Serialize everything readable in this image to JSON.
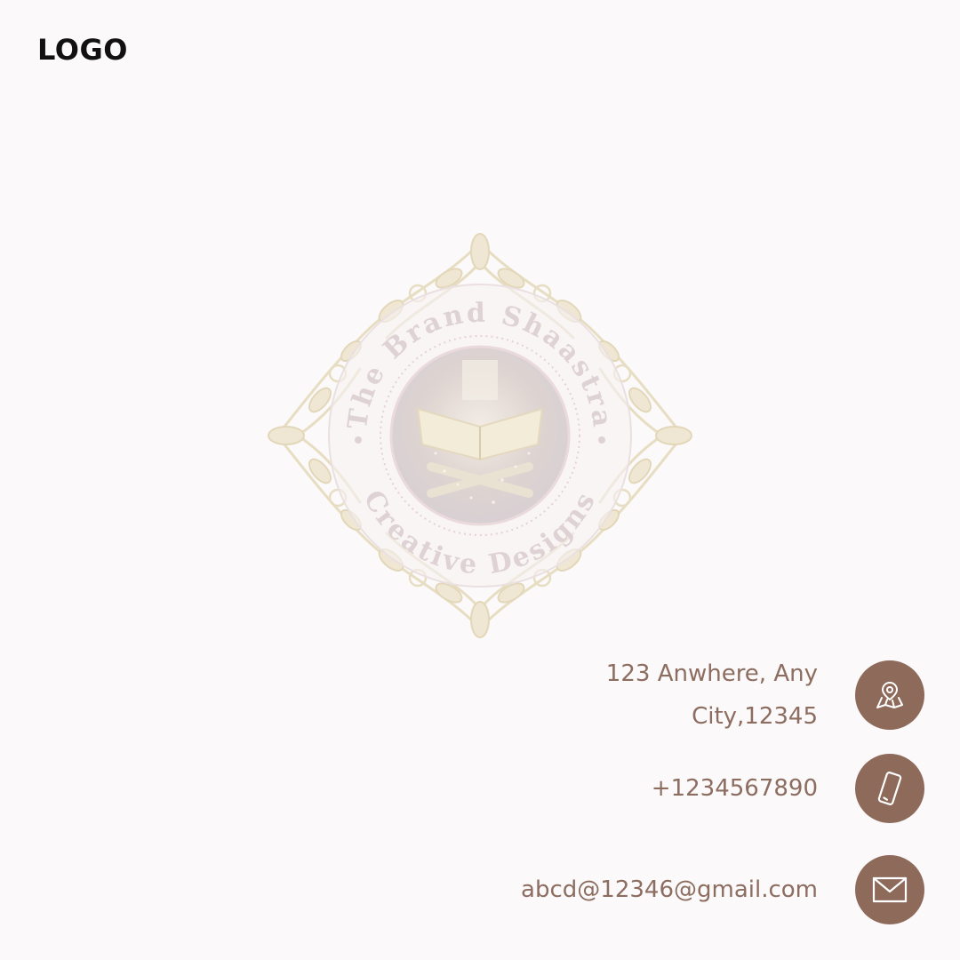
{
  "header": {
    "logo_label": "LOGO"
  },
  "emblem": {
    "brand_text_top": "The Brand Shaastra",
    "brand_text_bottom": "Creative Designs"
  },
  "contact": {
    "address_line1": "123 Anwhere, Any",
    "address_line2": "City,12345",
    "phone": "+1234567890",
    "email": "abcd@12346@gmail.com",
    "icons": [
      "map-pin-icon",
      "phone-icon",
      "mail-icon"
    ]
  },
  "colors": {
    "background": "#fbf9f9",
    "accent": "#8e6a5b",
    "contact_text": "#8c6d60",
    "logo_text": "#111111",
    "emblem_gold": "#e6dcc0",
    "emblem_pink": "#e5cfd3"
  }
}
